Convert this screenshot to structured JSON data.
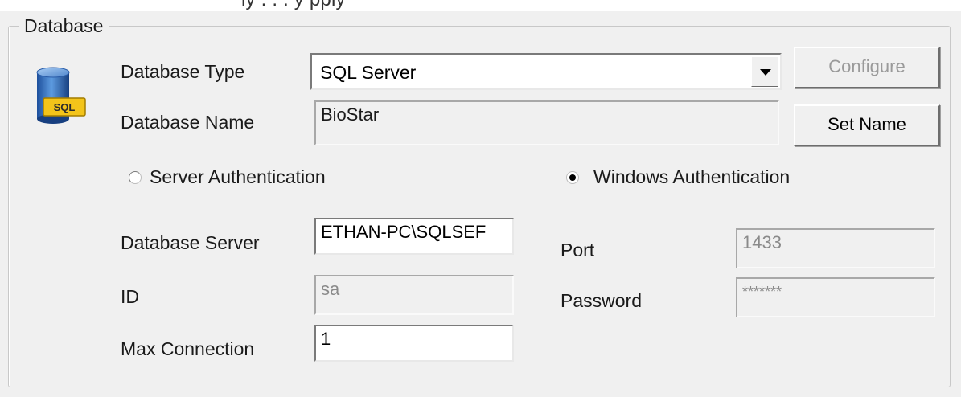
{
  "top_cut_text": "ly                                                               .  .  .  y                    pply",
  "group": {
    "title": "Database"
  },
  "icon": {
    "name": "database-sql-icon",
    "badge": "SQL"
  },
  "database_type": {
    "label": "Database Type",
    "value": "SQL Server"
  },
  "configure_button": {
    "label": "Configure",
    "enabled": false
  },
  "database_name": {
    "label": "Database Name",
    "value": "BioStar"
  },
  "set_name_button": {
    "label": "Set Name"
  },
  "auth": {
    "server_label": "Server Authentication",
    "windows_label": "Windows Authentication",
    "selected": "Windows Authentication"
  },
  "database_server": {
    "label": "Database Server",
    "value": "ETHAN-PC\\SQLSEF"
  },
  "port": {
    "label": "Port",
    "value": "1433"
  },
  "id": {
    "label": "ID",
    "value": "sa"
  },
  "password": {
    "label": "Password",
    "value": "*******"
  },
  "max_connection": {
    "label": "Max Connection",
    "value": "1"
  }
}
